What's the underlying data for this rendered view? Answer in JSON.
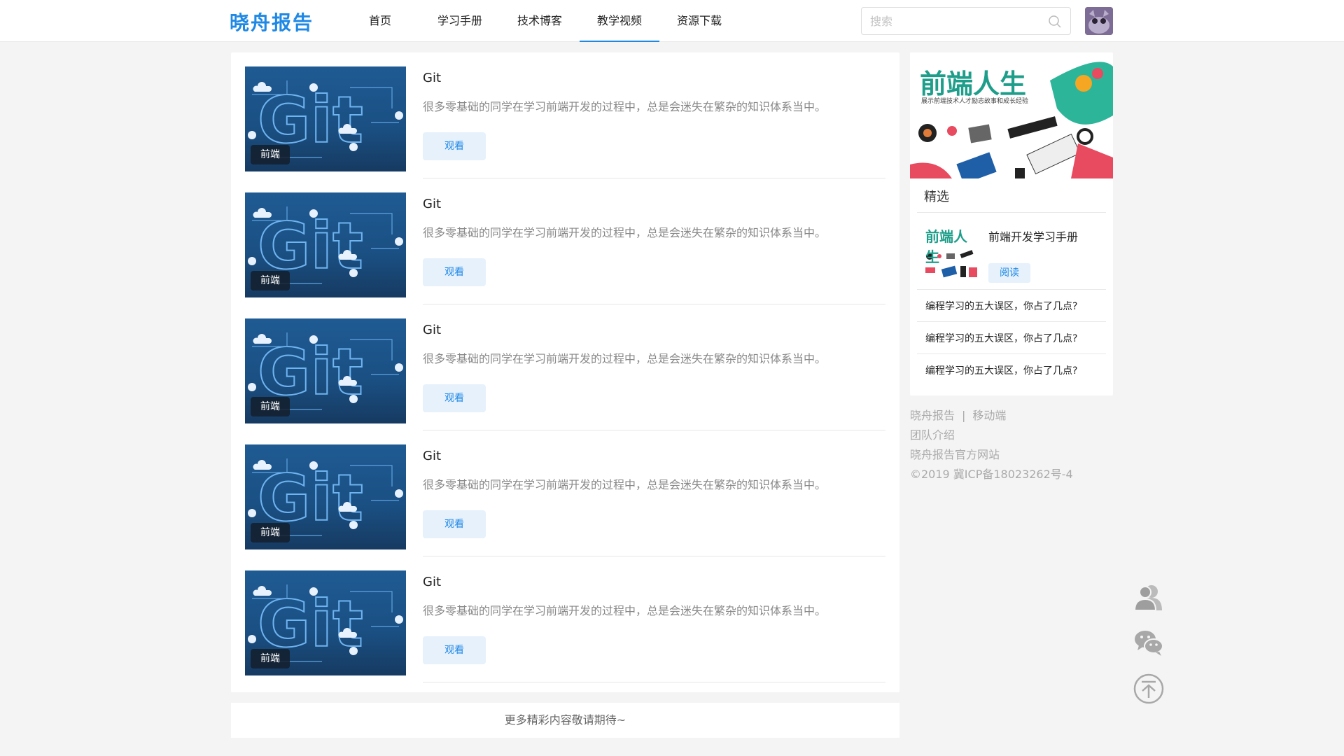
{
  "header": {
    "logo": "晓舟报告",
    "nav": [
      {
        "label": "首页",
        "active": false
      },
      {
        "label": "学习手册",
        "active": false
      },
      {
        "label": "技术博客",
        "active": false
      },
      {
        "label": "教学视频",
        "active": true
      },
      {
        "label": "资源下载",
        "active": false
      }
    ],
    "search_placeholder": "搜索",
    "accent_color": "#1e88e5"
  },
  "videos": [
    {
      "title": "Git",
      "thumb_text": "Git",
      "tag": "前端",
      "description": "很多零基础的同学在学习前端开发的过程中，总是会迷失在繁杂的知识体系当中。",
      "button": "观看"
    },
    {
      "title": "Git",
      "thumb_text": "Git",
      "tag": "前端",
      "description": "很多零基础的同学在学习前端开发的过程中，总是会迷失在繁杂的知识体系当中。",
      "button": "观看"
    },
    {
      "title": "Git",
      "thumb_text": "Git",
      "tag": "前端",
      "description": "很多零基础的同学在学习前端开发的过程中，总是会迷失在繁杂的知识体系当中。",
      "button": "观看"
    },
    {
      "title": "Git",
      "thumb_text": "Git",
      "tag": "前端",
      "description": "很多零基础的同学在学习前端开发的过程中，总是会迷失在繁杂的知识体系当中。",
      "button": "观看"
    },
    {
      "title": "Git",
      "thumb_text": "Git",
      "tag": "前端",
      "description": "很多零基础的同学在学习前端开发的过程中，总是会迷失在繁杂的知识体系当中。",
      "button": "观看"
    }
  ],
  "more_text": "更多精彩内容敬请期待~",
  "sidebar": {
    "banner_title": "前端人生",
    "banner_subtitle": "展示前端技术人才励志故事和成长经验",
    "heading": "精选",
    "featured": {
      "thumb_title": "前端人生",
      "title": "前端开发学习手册",
      "button": "阅读"
    },
    "links": [
      "编程学习的五大误区，你占了几点?",
      "编程学习的五大误区，你占了几点?",
      "编程学习的五大误区，你占了几点?"
    ]
  },
  "footer": {
    "brand": "晓舟报告",
    "separator": "|",
    "mobile": "移动端",
    "team": "团队介绍",
    "official": "晓舟报告官方网站",
    "icp": "©2019 冀ICP备18023262号-4"
  },
  "floating": {
    "icons": [
      "contact-icon",
      "wechat-icon",
      "back-to-top-icon"
    ]
  }
}
